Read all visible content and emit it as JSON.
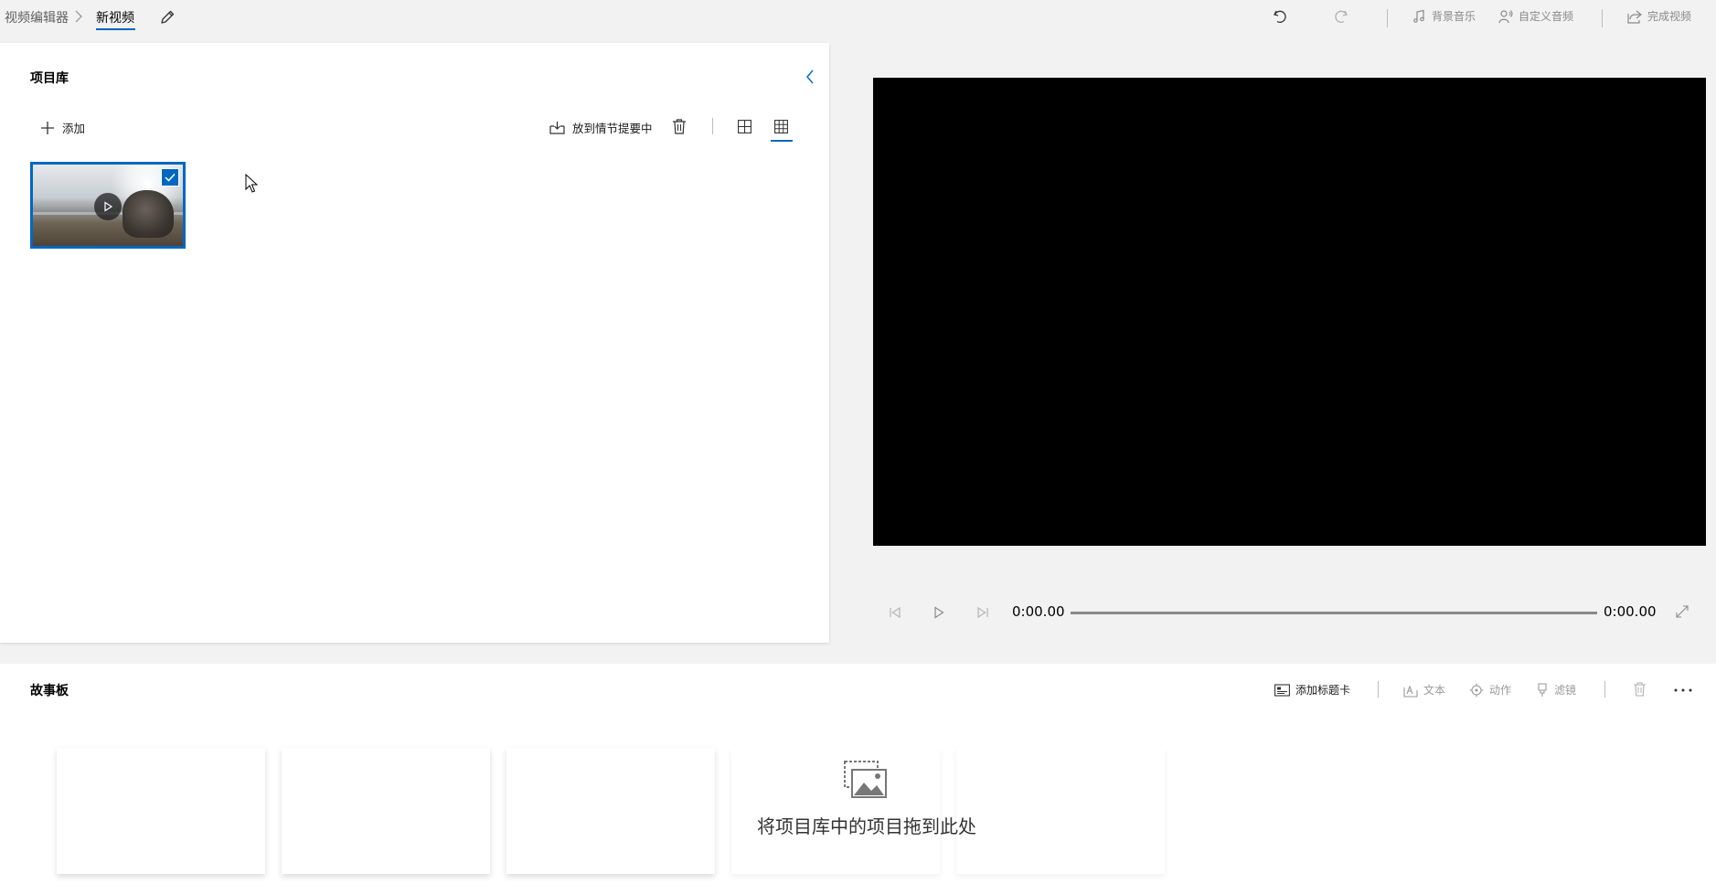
{
  "breadcrumb": {
    "root": "视频编辑器",
    "current": "新视频"
  },
  "toolbar": {
    "bg_music": "背景音乐",
    "custom_audio": "自定义音频",
    "finish_video": "完成视频"
  },
  "library": {
    "title": "项目库",
    "add_label": "添加",
    "place_in_storyboard": "放到情节提要中",
    "selected_view": "grid-small"
  },
  "player": {
    "current_time": "0:00.00",
    "total_time": "0:00.00",
    "progress": 0
  },
  "storyboard": {
    "title": "故事板",
    "add_title_card": "添加标题卡",
    "text": "文本",
    "motion": "动作",
    "filters": "滤镜",
    "drop_hint": "将项目库中的项目拖到此处"
  },
  "colors": {
    "accent": "#0067c0",
    "background": "#f2f2f2",
    "preview_bg": "#000000"
  },
  "icons": [
    "chevron-right-icon",
    "pencil-icon",
    "undo-icon",
    "redo-icon",
    "music-note-icon",
    "person-voice-icon",
    "share-icon",
    "chevron-left-icon",
    "plus-icon",
    "storyboard-import-icon",
    "trash-icon",
    "grid-large-icon",
    "grid-small-icon",
    "play-icon",
    "check-icon",
    "step-back-icon",
    "step-forward-icon",
    "fullscreen-icon",
    "title-card-icon",
    "text-icon",
    "motion-icon",
    "filter-icon",
    "more-icon",
    "images-icon"
  ]
}
